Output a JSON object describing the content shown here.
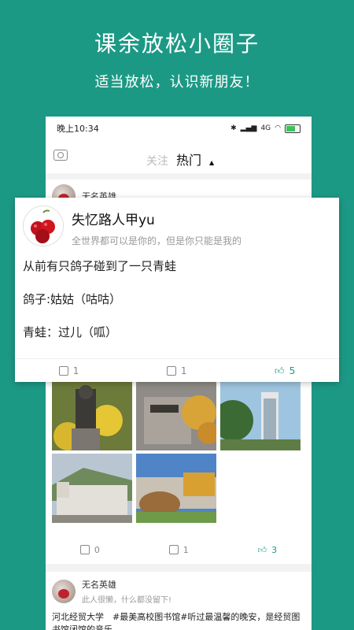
{
  "promo": {
    "headline": "课余放松小圈子",
    "subline": "适当放松，认识新朋友！"
  },
  "statusbar": {
    "time": "晚上10:34",
    "signal": "4G"
  },
  "topbar": {
    "tab_follow": "关注",
    "tab_hot": "热门"
  },
  "card_top": {
    "username": "无名英雄"
  },
  "popup": {
    "username": "失忆路人甲yu",
    "bio": "全世界都可以是你的，但是你只能是我的",
    "lines": [
      "从前有只鸽子碰到了一只青蛙",
      "鸽子:姑姑（咕咕）",
      "青蛙：过儿（呱）"
    ],
    "share_count": "1",
    "comment_count": "1",
    "like_count": "5"
  },
  "photo_card": {
    "share_count": "0",
    "comment_count": "1",
    "like_count": "3"
  },
  "card3": {
    "username": "无名英雄",
    "bio": "此人很懒，什么都没留下!",
    "text": "河北经贸大学　#最美高校图书馆#听过最温馨的晚安，是经贸图书馆闭馆的音乐。"
  },
  "colors": {
    "brand": "#1c9985",
    "like": "#1c9985"
  }
}
